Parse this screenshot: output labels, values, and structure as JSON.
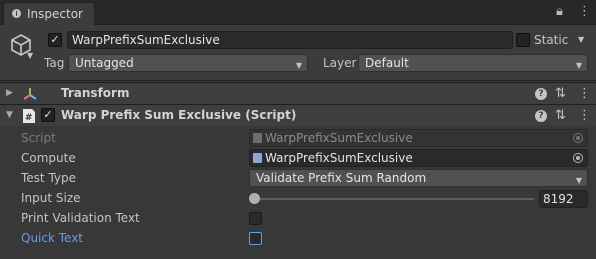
{
  "tab": {
    "label": "Inspector"
  },
  "gameobject": {
    "name": "WarpPrefixSumExclusive",
    "active_checked": true,
    "static_label": "Static",
    "tag_label": "Tag",
    "tag_value": "Untagged",
    "layer_label": "Layer",
    "layer_value": "Default"
  },
  "components": [
    {
      "title": "Transform",
      "icon": "transform-axes-icon"
    },
    {
      "title": "Warp Prefix Sum Exclusive (Script)",
      "icon": "script-icon",
      "enabled": true
    }
  ],
  "script_fields": {
    "script": {
      "label": "Script",
      "value": "WarpPrefixSumExclusive"
    },
    "compute": {
      "label": "Compute",
      "value": "WarpPrefixSumExclusive"
    },
    "test_type": {
      "label": "Test Type",
      "value": "Validate Prefix Sum Random"
    },
    "input_size": {
      "label": "Input Size",
      "value": "8192"
    },
    "print_validation": {
      "label": "Print Validation Text",
      "checked": false
    },
    "quick_text": {
      "label": "Quick Text",
      "checked": false
    }
  },
  "colors": {
    "background": "#383838",
    "header_bg": "#3c3c3c",
    "highlight_label": "#5f9ee6",
    "disabled_text": "#7c7c7c"
  }
}
